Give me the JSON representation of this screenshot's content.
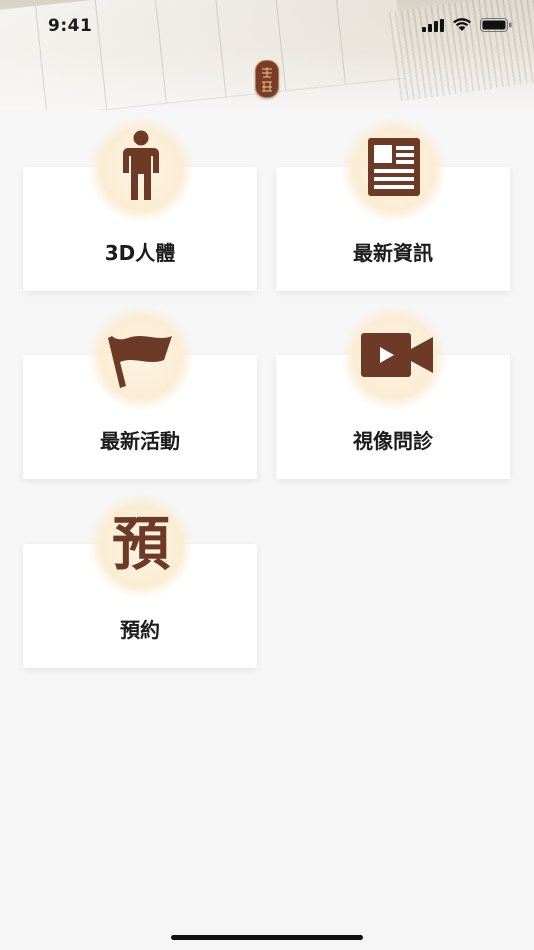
{
  "status_bar": {
    "time": "9:41"
  },
  "tiles": [
    {
      "label": "3D人體",
      "icon": "human-figure-icon"
    },
    {
      "label": "最新資訊",
      "icon": "newspaper-icon"
    },
    {
      "label": "最新活動",
      "icon": "flag-icon"
    },
    {
      "label": "視像問診",
      "icon": "video-camera-icon"
    },
    {
      "label": "預約",
      "icon": "yu-character-icon",
      "glyph": "預"
    }
  ],
  "colors": {
    "icon_brown": "#6e3a28",
    "halo": "#fbedd4",
    "background": "#f6f6f6"
  }
}
